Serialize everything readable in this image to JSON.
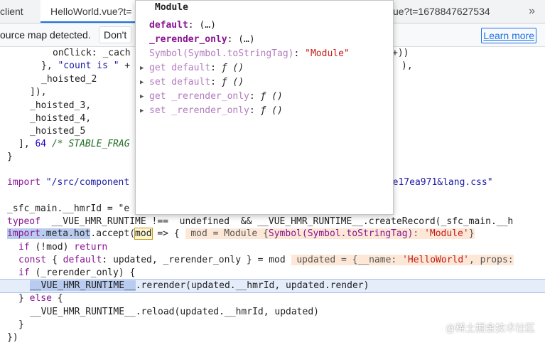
{
  "tabs": {
    "left": "client",
    "active": "HelloWorld.vue?t=",
    "right": "ue?t=1678847627534",
    "overflow_glyph": "»"
  },
  "infobar": {
    "message": "ource map detected.",
    "dont_label": "Don't",
    "learn_more": "Learn more"
  },
  "code": {
    "l1a": "onClick: _cach",
    "l1b": "+))",
    "l2a": "}, \"count is \" +",
    "l2b": "),",
    "l3": "_hoisted_2",
    "l4": "]),",
    "l5": "_hoisted_3,",
    "l6": "_hoisted_4,",
    "l7": "_hoisted_5",
    "l8a": "], ",
    "l8num": "64",
    "l8cmt": " /* STABLE_FRAG",
    "l9": "}",
    "l10a": "import ",
    "l10b": "\"/src/component",
    "l10c": "d=e17ea971&lang.css\"",
    "l11a": "_sfc_main.__hmrId = \"e",
    "l12a": "typeof",
    "l12b": "  __VUE_HMR_RUNTIME",
    "l12c": " !==  undefined  && __VUE_HMR_RUNTIME__.createRecord(_sfc_main.__h",
    "l13a": "import",
    "l13b": ".meta.hot",
    "l13c": ".accept(",
    "l13d": "mod",
    "l13e": " => {",
    "l13inl1": "mod = Module {",
    "l13inl2": "Symbol(Symbol.toStringTag)",
    "l13inl3": ": ",
    "l13inl4": "'Module'",
    "l13inl5": "}",
    "l14a": "if",
    "l14b": " (!mod) ",
    "l14c": "return",
    "l15a": "const",
    "l15b": " { ",
    "l15c": "default",
    "l15d": ": updated, _rerender_only } = mod",
    "l15inl1": "updated = {__name: ",
    "l15inl2": "'HelloWorld'",
    "l15inl3": ", props:",
    "l16a": "if",
    "l16b": " (_rerender_only) {",
    "l17a": "__VUE_HMR_RUNTIME__",
    "l17b": ".rerender(updated.__hmrId, updated.render)",
    "l18a": "} ",
    "l18b": "else",
    "l18c": " {",
    "l19": "__VUE_HMR_RUNTIME__.reload(updated.__hmrId, updated)",
    "l20": "}",
    "l21": "})"
  },
  "popover": {
    "title": "Module",
    "r1k": "default",
    "r1v": ": (…)",
    "r2k": "_rerender_only",
    "r2v": ": (…)",
    "r3k": "Symbol(Symbol.toStringTag)",
    "r3c": ": ",
    "r3v": "\"Module\"",
    "r4k": "get default",
    "r4c": ": ",
    "r4v": "ƒ ()",
    "r5k": "set default",
    "r5c": ": ",
    "r5v": "ƒ ()",
    "r6k": "get _rerender_only",
    "r6c": ": ",
    "r6v": "ƒ ()",
    "r7k": "set _rerender_only",
    "r7c": ": ",
    "r7v": "ƒ ()"
  },
  "watermark": "@稀土掘金技术社区"
}
